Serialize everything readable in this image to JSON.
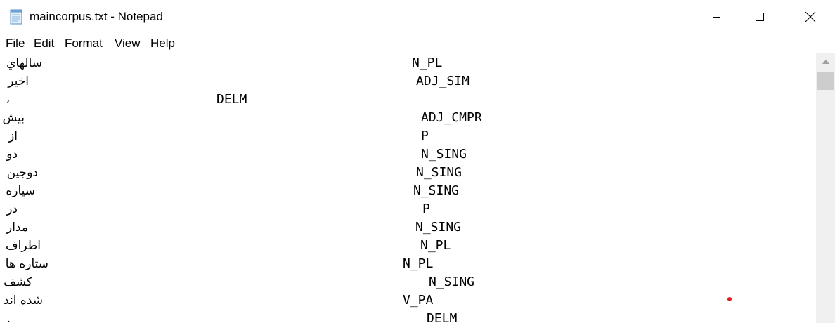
{
  "window": {
    "title": "maincorpus.txt - Notepad",
    "icon": "notepad-icon"
  },
  "menu": {
    "file": "File",
    "edit": "Edit",
    "format": "Format",
    "view": "View",
    "help": "Help"
  },
  "lines": [
    {
      "word": "سالهاي",
      "tag": "N_PL"
    },
    {
      "word": "اخير",
      "tag": "ADJ_SIM"
    },
    {
      "word": "،",
      "tag": "DELM"
    },
    {
      "word": "بيش",
      "tag": "ADJ_CMPR"
    },
    {
      "word": "از",
      "tag": "P"
    },
    {
      "word": "دو",
      "tag": "N_SING"
    },
    {
      "word": "دوجين",
      "tag": "N_SING"
    },
    {
      "word": "سياره",
      "tag": "N_SING"
    },
    {
      "word": "در",
      "tag": "P"
    },
    {
      "word": "مدار",
      "tag": "N_SING"
    },
    {
      "word": "اطراف",
      "tag": "N_PL"
    },
    {
      "word": "ستاره ها",
      "tag": "N_PL"
    },
    {
      "word": "كشف",
      "tag": "N_SING"
    },
    {
      "word": "شده اند",
      "tag": "V_PA"
    },
    {
      "word": ".",
      "tag": "DELM"
    }
  ],
  "colors": {
    "background": "#ffffff",
    "text": "#000000",
    "scrollbar_track": "#f0f0f0",
    "scrollbar_thumb": "#cdcdcd",
    "marker": "#e02020"
  }
}
